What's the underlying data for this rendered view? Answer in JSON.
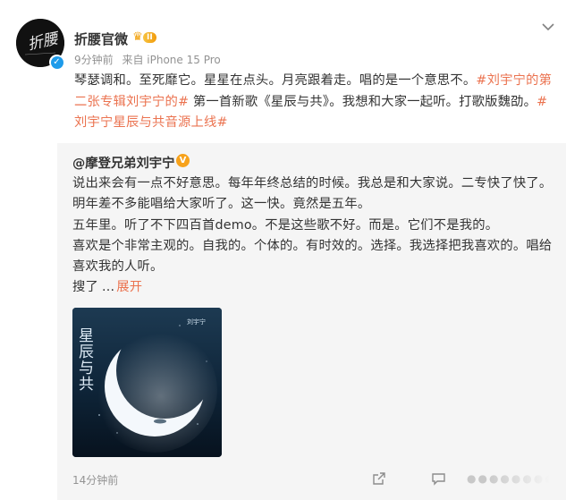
{
  "post": {
    "author": {
      "name": "折腰官微",
      "vip_level": "II",
      "verified": true,
      "avatar_text": "折腰"
    },
    "meta": {
      "time": "9分钟前",
      "source": "来自 iPhone 15 Pro"
    },
    "text": {
      "part1": "琴瑟调和。至死靡它。星星在点头。月亮跟着走。唱的是一个意思不。",
      "tag1": "#刘宇宁的第二张专辑刘宇宁的#",
      "part2": " 第一首新歌《星辰与共》。我想和大家一起听。打歌版魏劭。",
      "tag2": "#刘宇宁星辰与共音源上线#"
    },
    "icons": {
      "more": "chevron-down-icon",
      "verified": "verified-icon",
      "vip": "crown-icon"
    }
  },
  "repost": {
    "author": "@摩登兄弟刘宇宁",
    "badge": "V",
    "paragraphs": [
      "说出来会有一点不好意思。每年年终总结的时候。我总是和大家说。二专快了快了。明年差不多能唱给大家听了。这一快。竟然是五年。",
      "五年里。听了不下四百首demo。不是这些歌不好。而是。它们不是我的。",
      "喜欢是个非常主观的。自我的。个体的。有时效的。选择。我选择把我喜欢的。唱给喜欢我的人听。"
    ],
    "last_line": "搜了",
    "ellipsis": "...",
    "expand": "展开",
    "album": {
      "title": "星辰与共",
      "artist_small": "刘宇宁"
    },
    "time": "14分钟前",
    "icons": {
      "share": "share-icon",
      "comment": "comment-icon"
    }
  },
  "colors": {
    "accent": "#eb7350",
    "meta": "#939393",
    "repost_bg": "#f5f5f5",
    "verified": "#1e9bea",
    "vip": "#f29b0b"
  }
}
